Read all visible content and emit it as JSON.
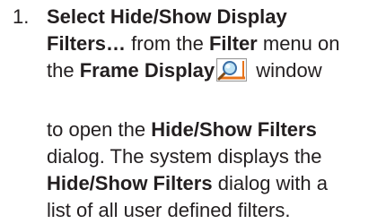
{
  "step": {
    "number": "1.",
    "line1": {
      "b1": "Select Hide/Show Display"
    },
    "line2": {
      "b1": "Filters…",
      "t1": " from the ",
      "b2": "Filter",
      "t2": " menu on"
    },
    "line3": {
      "t1": "the ",
      "b1": "Frame Display",
      "icon": "magnifier-icon",
      "t2": " window"
    },
    "line4": {
      "t1": "to open the ",
      "b1": "Hide/Show Filters"
    },
    "line5": {
      "t1": "dialog. The system displays the"
    },
    "line6": {
      "b1": "Hide/Show Filters",
      "t1": " dialog with a"
    },
    "line7": {
      "t1": "list of all user defined filters."
    }
  }
}
